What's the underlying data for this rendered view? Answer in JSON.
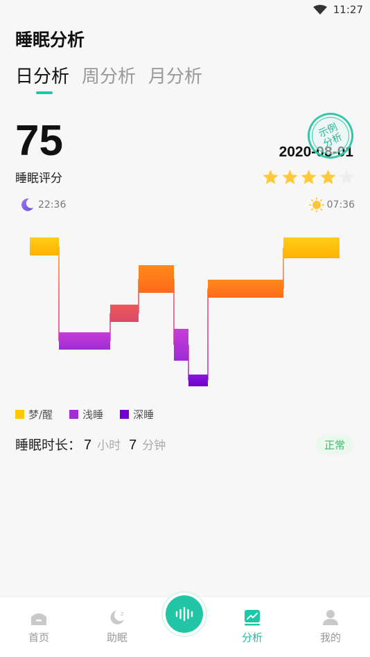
{
  "status_bar": {
    "time": "11:27"
  },
  "page_title": "睡眠分析",
  "tabs": [
    {
      "label": "日分析",
      "active": true
    },
    {
      "label": "周分析",
      "active": false
    },
    {
      "label": "月分析",
      "active": false
    }
  ],
  "summary": {
    "score": "75",
    "score_label": "睡眠评分",
    "date": "2020-08-01",
    "sample_stamp_lines": [
      "示例",
      "分析"
    ],
    "stars_filled": 4,
    "stars_total": 5,
    "bedtime": "22:36",
    "waketime": "07:36"
  },
  "colors": {
    "accent": "#1dc8a8",
    "dream_awake": "#ffc800",
    "light_sleep": "#a32cd6",
    "deep_sleep": "#7000d6",
    "star": "#ffc93c",
    "star_empty": "#eeeeee"
  },
  "chart_data": {
    "type": "step",
    "levels": [
      "梦/醒",
      "浅睡",
      "深睡"
    ],
    "stage_sequence": [
      "梦/醒",
      "浅睡",
      "浅睡",
      "梦/醒",
      "浅睡",
      "深睡",
      "梦/醒",
      "梦/醒"
    ],
    "notes": "Hypnogram from 22:36 to 07:36"
  },
  "legend": [
    {
      "label": "梦/醒",
      "color": "#ffc800"
    },
    {
      "label": "浅睡",
      "color": "#a32cd6"
    },
    {
      "label": "深睡",
      "color": "#7000d6"
    }
  ],
  "duration": {
    "label": "睡眠时长：",
    "hours": "7",
    "hours_unit": "小时",
    "minutes": "7",
    "minutes_unit": "分钟",
    "status": "正常"
  },
  "bottom_nav": [
    {
      "label": "首页",
      "icon": "home-icon",
      "active": false
    },
    {
      "label": "助眠",
      "icon": "moon-icon",
      "active": false
    },
    {
      "label": "分析",
      "icon": "chart-icon",
      "active": true
    },
    {
      "label": "我的",
      "icon": "user-icon",
      "active": false
    }
  ],
  "center_button": {
    "icon": "sound-wave-icon"
  }
}
